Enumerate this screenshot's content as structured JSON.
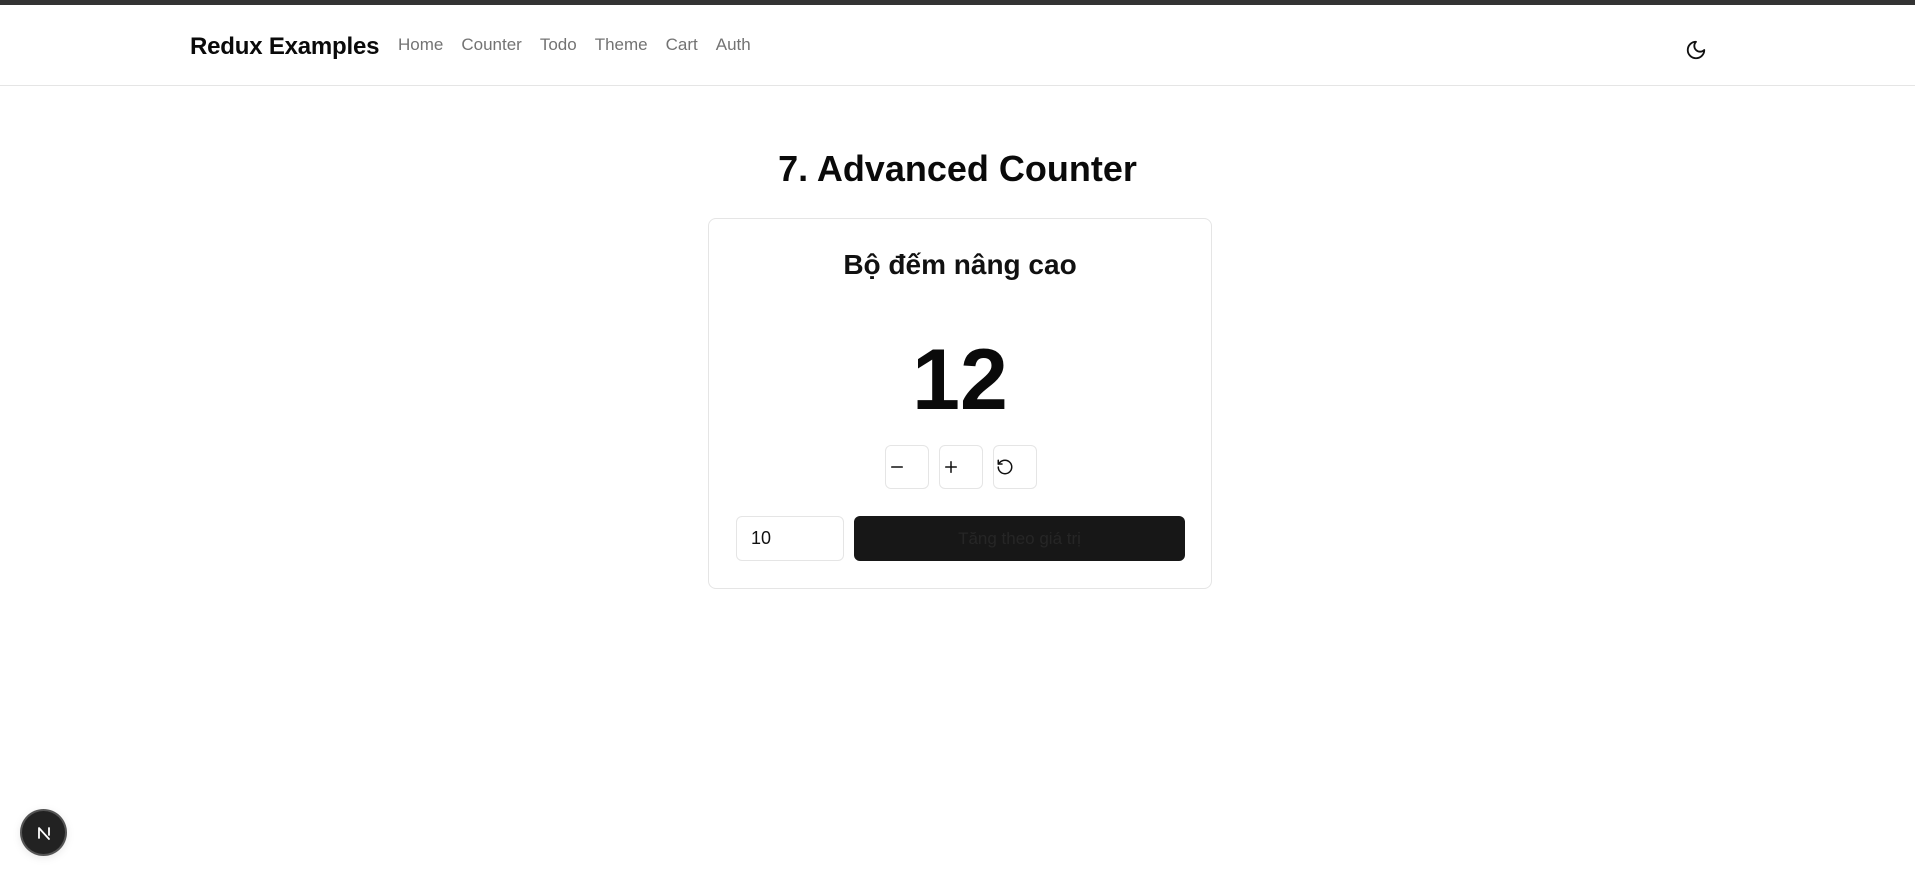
{
  "navbar": {
    "brand": "Redux Examples",
    "links": [
      "Home",
      "Counter",
      "Todo",
      "Theme",
      "Cart",
      "Auth"
    ],
    "theme_icon": "moon-icon"
  },
  "page": {
    "title": "7. Advanced Counter"
  },
  "card": {
    "title": "Bộ đếm nâng cao",
    "count": "12",
    "decrement_icon": "minus-icon",
    "increment_icon": "plus-icon",
    "reset_icon": "rotate-ccw-icon",
    "amount_value": "10",
    "add_button_label": "Tăng theo giá trị"
  },
  "devtools": {
    "badge_icon": "nextjs-logo-icon"
  }
}
